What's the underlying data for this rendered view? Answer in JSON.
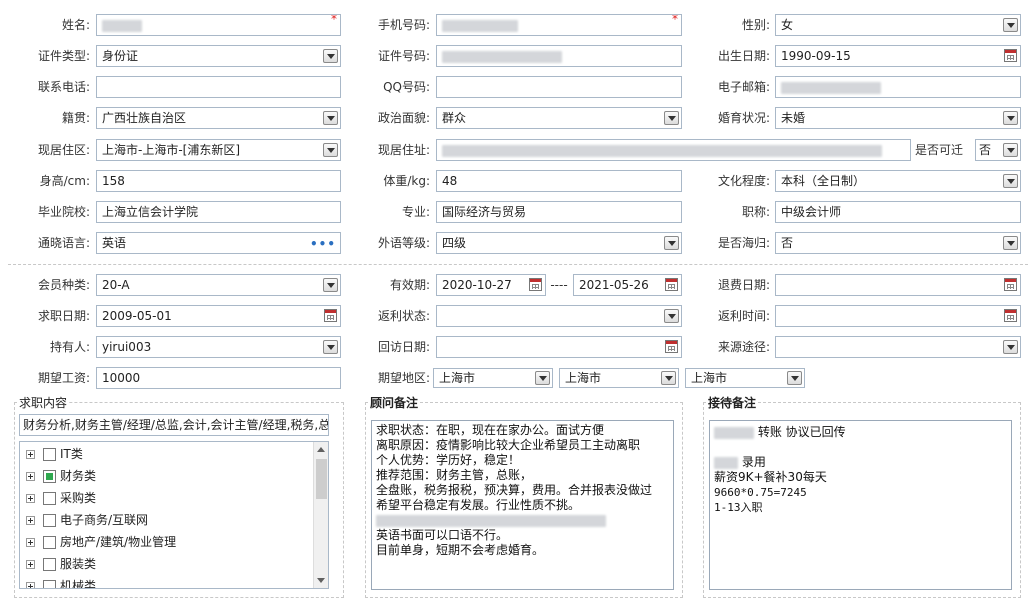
{
  "basic": {
    "name": {
      "label": "姓名:"
    },
    "mobile": {
      "label": "手机号码:"
    },
    "gender": {
      "label": "性别:",
      "value": "女"
    },
    "id_type": {
      "label": "证件类型:",
      "value": "身份证"
    },
    "id_number": {
      "label": "证件号码:"
    },
    "birth_date": {
      "label": "出生日期:",
      "value": "1990-09-15"
    },
    "phone": {
      "label": "联系电话:",
      "value": ""
    },
    "qq": {
      "label": "QQ号码:",
      "value": ""
    },
    "email": {
      "label": "电子邮箱:"
    },
    "native_place": {
      "label": "籍贯:",
      "value": "广西壮族自治区"
    },
    "political": {
      "label": "政治面貌:",
      "value": "群众"
    },
    "marital": {
      "label": "婚育状况:",
      "value": "未婚"
    },
    "residence_area": {
      "label": "现居住区:",
      "value": "上海市-上海市-[浦东新区]"
    },
    "residence_addr": {
      "label": "现居住址:"
    },
    "relocatable": {
      "label": "是否可迁",
      "value": "否"
    },
    "height": {
      "label": "身高/cm:",
      "value": "158"
    },
    "weight": {
      "label": "体重/kg:",
      "value": "48"
    },
    "education": {
      "label": "文化程度:",
      "value": "本科（全日制）"
    },
    "school": {
      "label": "毕业院校:",
      "value": "上海立信会计学院"
    },
    "major": {
      "label": "专业:",
      "value": "国际经济与贸易"
    },
    "title": {
      "label": "职称:",
      "value": "中级会计师"
    },
    "language": {
      "label": "通晓语言:",
      "value": "英语",
      "more": "•••"
    },
    "lang_level": {
      "label": "外语等级:",
      "value": "四级"
    },
    "returnee": {
      "label": "是否海归:",
      "value": "否"
    }
  },
  "member": {
    "type": {
      "label": "会员种类:",
      "value": "20-A"
    },
    "validity": {
      "label": "有效期:",
      "from": "2020-10-27",
      "sep": "----",
      "to": "2021-05-26"
    },
    "refund_date": {
      "label": "退费日期:",
      "value": ""
    },
    "job_date": {
      "label": "求职日期:",
      "value": "2009-05-01"
    },
    "rebate_status": {
      "label": "返利状态:",
      "value": ""
    },
    "rebate_time": {
      "label": "返利时间:",
      "value": ""
    },
    "holder": {
      "label": "持有人:",
      "value": "yirui003"
    },
    "revisit_date": {
      "label": "回访日期:",
      "value": ""
    },
    "source": {
      "label": "来源途径:",
      "value": ""
    },
    "salary": {
      "label": "期望工资:",
      "value": "10000"
    },
    "region": {
      "label": "期望地区:",
      "province": "上海市",
      "city": "上海市",
      "district": "上海市"
    }
  },
  "job_content": {
    "title": "求职内容",
    "summary": "财务分析,财务主管/经理/总监,会计,会计主管/经理,税务,总",
    "tree": [
      {
        "label": "IT类"
      },
      {
        "label": "财务类"
      },
      {
        "label": "采购类"
      },
      {
        "label": "电子商务/互联网"
      },
      {
        "label": "房地产/建筑/物业管理"
      },
      {
        "label": "服装类"
      },
      {
        "label": "机械类"
      }
    ]
  },
  "consultant_notes": {
    "title": "顾问备注",
    "lines": [
      "求职状态：在职，现在在家办公。面试方便",
      "离职原因：疫情影响比较大企业希望员工主动离职",
      "个人优势：学历好，稳定！",
      "推荐范围：财务主管，总账，",
      "全盘账，税务报税，预决算，费用。合并报表没做过",
      "希望平台稳定有发展。行业性质不挑。",
      "",
      "英语书面可以口语不行。",
      "目前单身，短期不会考虑婚育。"
    ]
  },
  "reception_notes": {
    "title": "接待备注",
    "line1": "转账   协议已回传",
    "line2": "录用",
    "line3": "薪资9K+餐补30每天",
    "line4": "9660*0.75=7245",
    "line5": "1-13入职"
  }
}
